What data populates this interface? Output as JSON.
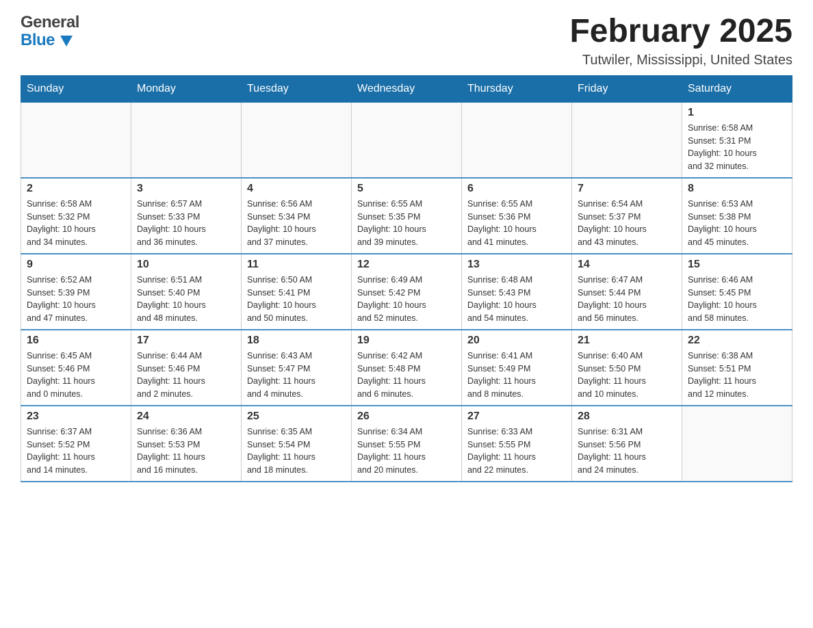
{
  "header": {
    "logo_general": "General",
    "logo_blue": "Blue",
    "month_title": "February 2025",
    "location": "Tutwiler, Mississippi, United States"
  },
  "weekdays": [
    "Sunday",
    "Monday",
    "Tuesday",
    "Wednesday",
    "Thursday",
    "Friday",
    "Saturday"
  ],
  "weeks": [
    [
      {
        "day": "",
        "info": ""
      },
      {
        "day": "",
        "info": ""
      },
      {
        "day": "",
        "info": ""
      },
      {
        "day": "",
        "info": ""
      },
      {
        "day": "",
        "info": ""
      },
      {
        "day": "",
        "info": ""
      },
      {
        "day": "1",
        "info": "Sunrise: 6:58 AM\nSunset: 5:31 PM\nDaylight: 10 hours\nand 32 minutes."
      }
    ],
    [
      {
        "day": "2",
        "info": "Sunrise: 6:58 AM\nSunset: 5:32 PM\nDaylight: 10 hours\nand 34 minutes."
      },
      {
        "day": "3",
        "info": "Sunrise: 6:57 AM\nSunset: 5:33 PM\nDaylight: 10 hours\nand 36 minutes."
      },
      {
        "day": "4",
        "info": "Sunrise: 6:56 AM\nSunset: 5:34 PM\nDaylight: 10 hours\nand 37 minutes."
      },
      {
        "day": "5",
        "info": "Sunrise: 6:55 AM\nSunset: 5:35 PM\nDaylight: 10 hours\nand 39 minutes."
      },
      {
        "day": "6",
        "info": "Sunrise: 6:55 AM\nSunset: 5:36 PM\nDaylight: 10 hours\nand 41 minutes."
      },
      {
        "day": "7",
        "info": "Sunrise: 6:54 AM\nSunset: 5:37 PM\nDaylight: 10 hours\nand 43 minutes."
      },
      {
        "day": "8",
        "info": "Sunrise: 6:53 AM\nSunset: 5:38 PM\nDaylight: 10 hours\nand 45 minutes."
      }
    ],
    [
      {
        "day": "9",
        "info": "Sunrise: 6:52 AM\nSunset: 5:39 PM\nDaylight: 10 hours\nand 47 minutes."
      },
      {
        "day": "10",
        "info": "Sunrise: 6:51 AM\nSunset: 5:40 PM\nDaylight: 10 hours\nand 48 minutes."
      },
      {
        "day": "11",
        "info": "Sunrise: 6:50 AM\nSunset: 5:41 PM\nDaylight: 10 hours\nand 50 minutes."
      },
      {
        "day": "12",
        "info": "Sunrise: 6:49 AM\nSunset: 5:42 PM\nDaylight: 10 hours\nand 52 minutes."
      },
      {
        "day": "13",
        "info": "Sunrise: 6:48 AM\nSunset: 5:43 PM\nDaylight: 10 hours\nand 54 minutes."
      },
      {
        "day": "14",
        "info": "Sunrise: 6:47 AM\nSunset: 5:44 PM\nDaylight: 10 hours\nand 56 minutes."
      },
      {
        "day": "15",
        "info": "Sunrise: 6:46 AM\nSunset: 5:45 PM\nDaylight: 10 hours\nand 58 minutes."
      }
    ],
    [
      {
        "day": "16",
        "info": "Sunrise: 6:45 AM\nSunset: 5:46 PM\nDaylight: 11 hours\nand 0 minutes."
      },
      {
        "day": "17",
        "info": "Sunrise: 6:44 AM\nSunset: 5:46 PM\nDaylight: 11 hours\nand 2 minutes."
      },
      {
        "day": "18",
        "info": "Sunrise: 6:43 AM\nSunset: 5:47 PM\nDaylight: 11 hours\nand 4 minutes."
      },
      {
        "day": "19",
        "info": "Sunrise: 6:42 AM\nSunset: 5:48 PM\nDaylight: 11 hours\nand 6 minutes."
      },
      {
        "day": "20",
        "info": "Sunrise: 6:41 AM\nSunset: 5:49 PM\nDaylight: 11 hours\nand 8 minutes."
      },
      {
        "day": "21",
        "info": "Sunrise: 6:40 AM\nSunset: 5:50 PM\nDaylight: 11 hours\nand 10 minutes."
      },
      {
        "day": "22",
        "info": "Sunrise: 6:38 AM\nSunset: 5:51 PM\nDaylight: 11 hours\nand 12 minutes."
      }
    ],
    [
      {
        "day": "23",
        "info": "Sunrise: 6:37 AM\nSunset: 5:52 PM\nDaylight: 11 hours\nand 14 minutes."
      },
      {
        "day": "24",
        "info": "Sunrise: 6:36 AM\nSunset: 5:53 PM\nDaylight: 11 hours\nand 16 minutes."
      },
      {
        "day": "25",
        "info": "Sunrise: 6:35 AM\nSunset: 5:54 PM\nDaylight: 11 hours\nand 18 minutes."
      },
      {
        "day": "26",
        "info": "Sunrise: 6:34 AM\nSunset: 5:55 PM\nDaylight: 11 hours\nand 20 minutes."
      },
      {
        "day": "27",
        "info": "Sunrise: 6:33 AM\nSunset: 5:55 PM\nDaylight: 11 hours\nand 22 minutes."
      },
      {
        "day": "28",
        "info": "Sunrise: 6:31 AM\nSunset: 5:56 PM\nDaylight: 11 hours\nand 24 minutes."
      },
      {
        "day": "",
        "info": ""
      }
    ]
  ]
}
